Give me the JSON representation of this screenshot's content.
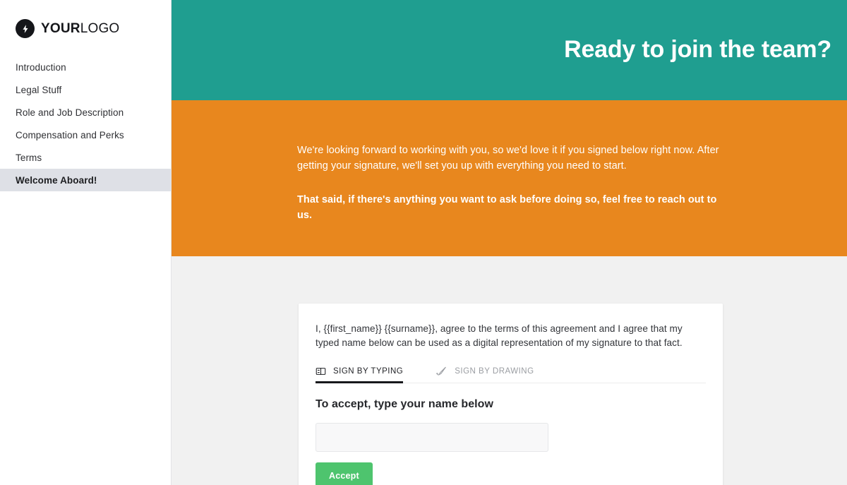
{
  "brand": {
    "logo_bold": "YOUR",
    "logo_light": "LOGO",
    "logo_icon": "lightning-bolt-icon",
    "teal": "#1F9E90",
    "orange": "#E8871E",
    "green": "#4EC46E",
    "active_nav_bg": "#DEE0E6"
  },
  "sidebar": {
    "items": [
      {
        "label": "Introduction",
        "active": false
      },
      {
        "label": "Legal Stuff",
        "active": false
      },
      {
        "label": "Role and Job Description",
        "active": false
      },
      {
        "label": "Compensation and Perks",
        "active": false
      },
      {
        "label": "Terms",
        "active": false
      },
      {
        "label": "Welcome Aboard!",
        "active": true
      }
    ]
  },
  "hero": {
    "title": "Ready to join the team?"
  },
  "intro": {
    "lead": "We're looking forward to working with you, so we'd love it if you signed below right now. After getting your signature, we'll set you up with everything you need to start.",
    "cta": "That said, if there's anything you want to ask before doing so, feel free to reach out to us."
  },
  "signature_card": {
    "consent": "I, {{first_name}} {{surname}}, agree to the terms of this agreement and I agree that my typed name below can be used as a digital representation of my signature to that fact.",
    "tabs": [
      {
        "label": "Sign by typing",
        "icon": "keyboard-icon",
        "active": true
      },
      {
        "label": "Sign by drawing",
        "icon": "pen-icon",
        "active": false
      }
    ],
    "accept_heading": "To accept, type your name below",
    "name_input_value": "",
    "name_input_placeholder": "",
    "accept_button_label": "Accept"
  }
}
